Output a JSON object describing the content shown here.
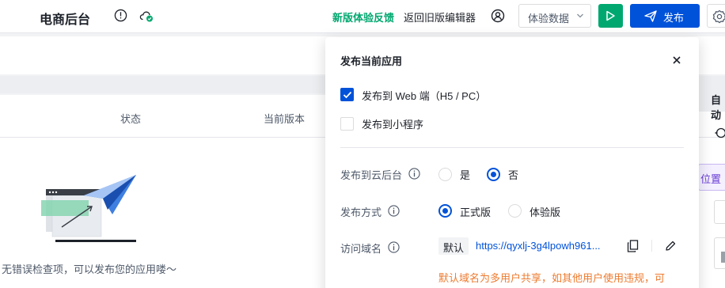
{
  "header": {
    "app_title": "电商后台",
    "feedback_link": "新版体验反馈",
    "back_link": "返回旧版编辑器",
    "env_select": "体验数据",
    "publish_label": "发布",
    "colors": {
      "green": "#00a870",
      "blue": "#0052d9"
    }
  },
  "background": {
    "table_headers": [
      "状态",
      "当前版本"
    ],
    "empty_message": "无错误检查项，可以发布您的应用喽～",
    "right_tab": "自动",
    "right_chip": "位置"
  },
  "publish_panel": {
    "title": "发布当前应用",
    "targets": [
      {
        "label": "发布到 Web 端（H5 / PC）",
        "checked": true
      },
      {
        "label": "发布到小程序",
        "checked": false
      }
    ],
    "cloud_backend": {
      "label": "发布到云后台",
      "options": [
        "是",
        "否"
      ],
      "selected": "否"
    },
    "publish_mode": {
      "label": "发布方式",
      "options": [
        "正式版",
        "体验版"
      ],
      "selected": "正式版"
    },
    "domain": {
      "label": "访问域名",
      "tag": "默认",
      "url": "https://qyxlj-3g4lpowh961..."
    },
    "warning": "默认域名为多用户共享，如其他用户使用违规，可"
  }
}
